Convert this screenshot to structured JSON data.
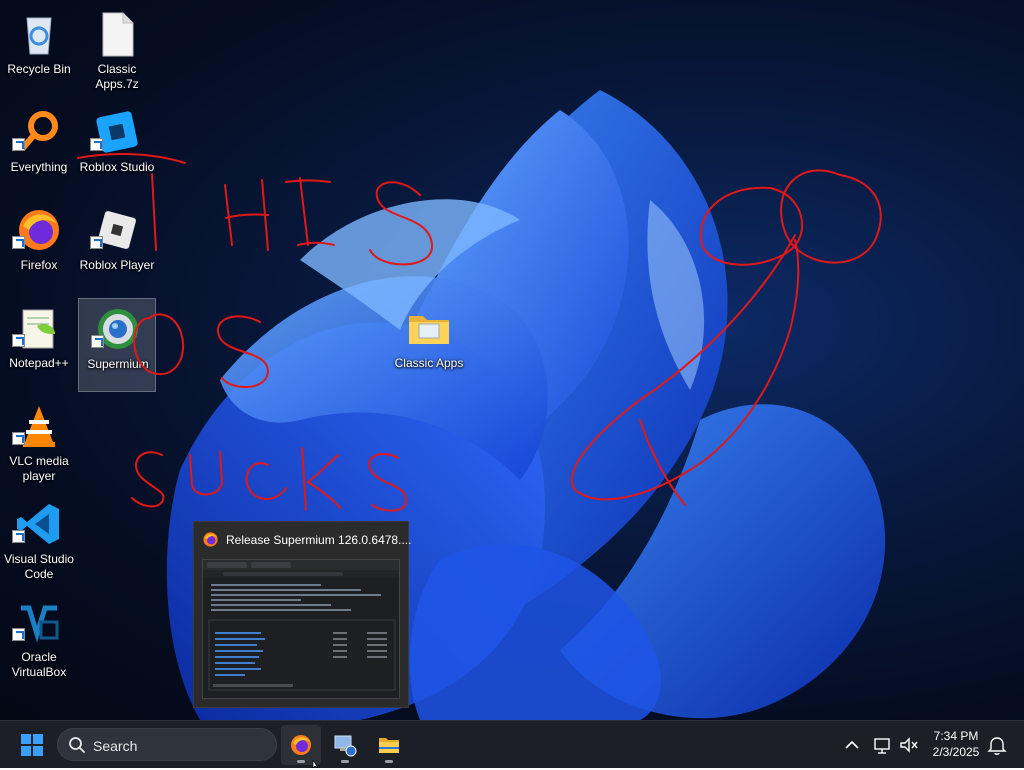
{
  "desktop": {
    "icons": [
      {
        "label": "Recycle Bin",
        "icon": "recycle-bin-icon"
      },
      {
        "label": "Classic Apps.7z",
        "icon": "archive-file-icon"
      },
      {
        "label": "Everything",
        "icon": "everything-search-icon"
      },
      {
        "label": "Roblox Studio",
        "icon": "roblox-studio-icon"
      },
      {
        "label": "Firefox",
        "icon": "firefox-icon"
      },
      {
        "label": "Roblox Player",
        "icon": "roblox-player-icon"
      },
      {
        "label": "Notepad++",
        "icon": "notepad-plus-plus-icon"
      },
      {
        "label": "Supermium",
        "icon": "supermium-icon"
      },
      {
        "label": "Classic Apps",
        "icon": "folder-icon"
      },
      {
        "label": "VLC media player",
        "icon": "vlc-icon"
      },
      {
        "label": "Visual Studio Code",
        "icon": "vscode-icon"
      },
      {
        "label": "Oracle VirtualBox",
        "icon": "virtualbox-icon"
      }
    ],
    "scribble_color": "#e01818"
  },
  "taskbar_preview": {
    "title": "Release Supermium 126.0.6478....",
    "icon": "firefox-icon"
  },
  "taskbar": {
    "start_icon": "windows-start-icon",
    "search_placeholder": "Search",
    "pinned": [
      {
        "name": "Firefox",
        "icon": "firefox-icon",
        "active": true
      },
      {
        "name": "Network",
        "icon": "network-computer-icon",
        "active": true
      },
      {
        "name": "File Explorer",
        "icon": "folder-icon",
        "active": true
      }
    ],
    "tray": {
      "chevron_icon": "chevron-up-icon",
      "time": "7:34 PM",
      "date": "2/3/2025"
    },
    "accent": "#0078d4"
  }
}
